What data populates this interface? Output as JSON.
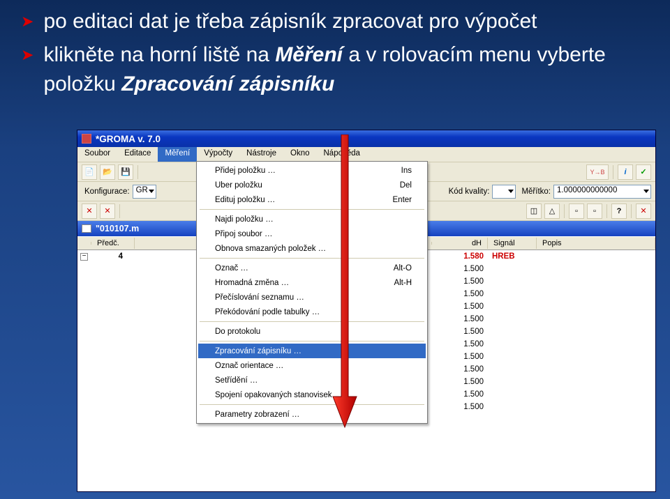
{
  "bullets": {
    "b1": "po editaci dat je třeba zápisník zpracovat pro výpočet",
    "b2_a": "klikněte na horní liště na ",
    "b2_em": "Měření",
    "b2_b": " a v rolovacím menu vyberte položku ",
    "b2_em2": "Zpracování zápisníku"
  },
  "window": {
    "title": "*GROMA v. 7.0"
  },
  "menubar": [
    "Soubor",
    "Editace",
    "Měření",
    "Výpočty",
    "Nástroje",
    "Okno",
    "Nápověda"
  ],
  "toolbar2": {
    "konfig_label": "Konfigurace:",
    "konfig_value": "GR",
    "kod_label": "Kód kvality:",
    "meritko_label": "Měřítko:",
    "meritko_value": "1.000000000000"
  },
  "subwin": {
    "title": "\"010107.m"
  },
  "grid": {
    "headers": {
      "predc": "Předč.",
      "dh": "dH",
      "signal": "Signál",
      "popis": "Popis"
    },
    "first_num": "4",
    "rows": [
      {
        "dh": "1.580",
        "signal": "HREB",
        "red": true
      },
      {
        "dh": "1.500"
      },
      {
        "dh": "1.500"
      },
      {
        "dh": "1.500"
      },
      {
        "dh": "1.500"
      },
      {
        "dh": "1.500"
      },
      {
        "dh": "1.500"
      },
      {
        "dh": "1.500"
      },
      {
        "dh": "1.500"
      },
      {
        "dh": "1.500"
      },
      {
        "dh": "1.500"
      },
      {
        "dh": "1.500"
      },
      {
        "dh": "1.500"
      }
    ]
  },
  "dropdown": [
    {
      "label": "Přidej položku …",
      "shortcut": "Ins"
    },
    {
      "label": "Uber položku",
      "shortcut": "Del"
    },
    {
      "label": "Edituj položku …",
      "shortcut": "Enter"
    },
    {
      "sep": true
    },
    {
      "label": "Najdi položku …"
    },
    {
      "label": "Připoj soubor …"
    },
    {
      "label": "Obnova smazaných položek …"
    },
    {
      "sep": true
    },
    {
      "label": "Označ …",
      "shortcut": "Alt-O"
    },
    {
      "label": "Hromadná změna …",
      "shortcut": "Alt-H"
    },
    {
      "label": "Přečíslování seznamu …"
    },
    {
      "label": "Překódování podle tabulky …"
    },
    {
      "sep": true
    },
    {
      "label": "Do protokolu"
    },
    {
      "sep": true
    },
    {
      "label": "Zpracování zápisníku …",
      "hl": true
    },
    {
      "label": "Označ orientace …"
    },
    {
      "label": "Setřídění …"
    },
    {
      "label": "Spojení opakovaných stanovisek …"
    },
    {
      "sep": true
    },
    {
      "label": "Parametry zobrazení …"
    }
  ],
  "icons": {
    "i_info": "i",
    "i_check": "✓",
    "i_help": "?",
    "i_yb": "Y→B"
  }
}
